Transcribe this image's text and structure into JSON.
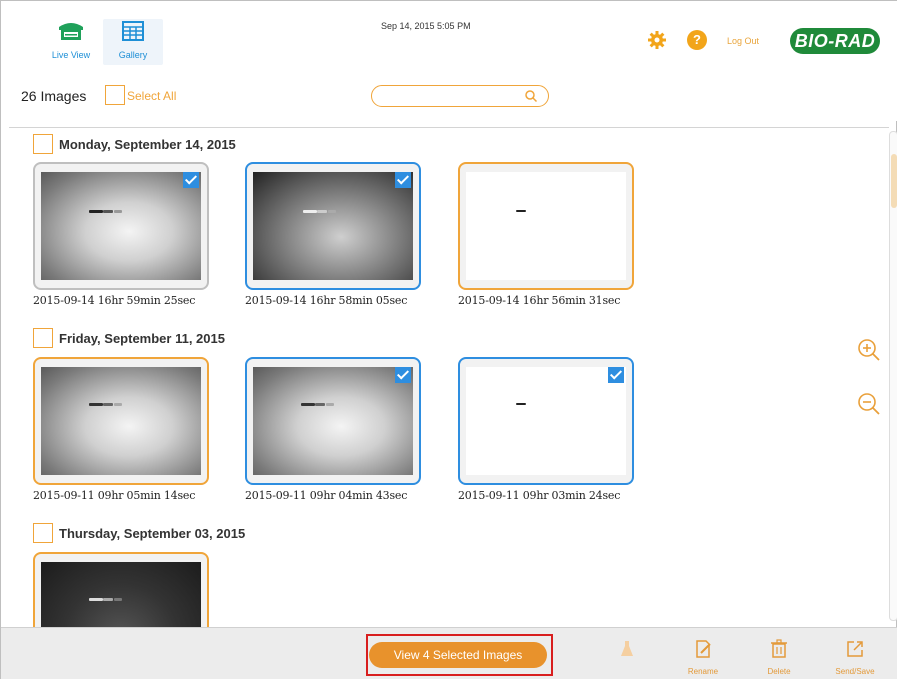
{
  "header": {
    "nav": [
      {
        "label": "Live View",
        "icon": "live-view-icon"
      },
      {
        "label": "Gallery",
        "icon": "gallery-icon"
      }
    ],
    "datetime": "Sep 14, 2015  5:05 PM",
    "logout_label": "Log Out",
    "brand": "BIO-RAD",
    "brand_color": "#1f8a3a",
    "accent_color": "#f0a53a"
  },
  "toolbar": {
    "image_count": "26 Images",
    "select_all_label": "Select All",
    "search_placeholder": ""
  },
  "groups": [
    {
      "date": "Monday, September 14, 2015",
      "images": [
        {
          "caption": "2015-09-14 16hr 59min 25sec",
          "selected": true
        },
        {
          "caption": "2015-09-14 16hr 58min 05sec",
          "selected": true
        },
        {
          "caption": "2015-09-14 16hr 56min 31sec",
          "selected": false
        }
      ]
    },
    {
      "date": "Friday, September 11, 2015",
      "images": [
        {
          "caption": "2015-09-11 09hr 05min 14sec",
          "selected": false
        },
        {
          "caption": "2015-09-11 09hr 04min 43sec",
          "selected": true
        },
        {
          "caption": "2015-09-11 09hr 03min 24sec",
          "selected": true
        }
      ]
    },
    {
      "date": "Thursday, September 03, 2015",
      "images": [
        {
          "caption": "",
          "selected": false
        }
      ]
    }
  ],
  "bottom": {
    "view_selected_label": "View 4 Selected Images",
    "tools": [
      {
        "label": "",
        "icon": "flask-icon",
        "disabled": true
      },
      {
        "label": "Rename",
        "icon": "rename-icon",
        "disabled": false
      },
      {
        "label": "Delete",
        "icon": "trash-icon",
        "disabled": false
      },
      {
        "label": "Send/Save",
        "icon": "share-icon",
        "disabled": false
      }
    ]
  }
}
